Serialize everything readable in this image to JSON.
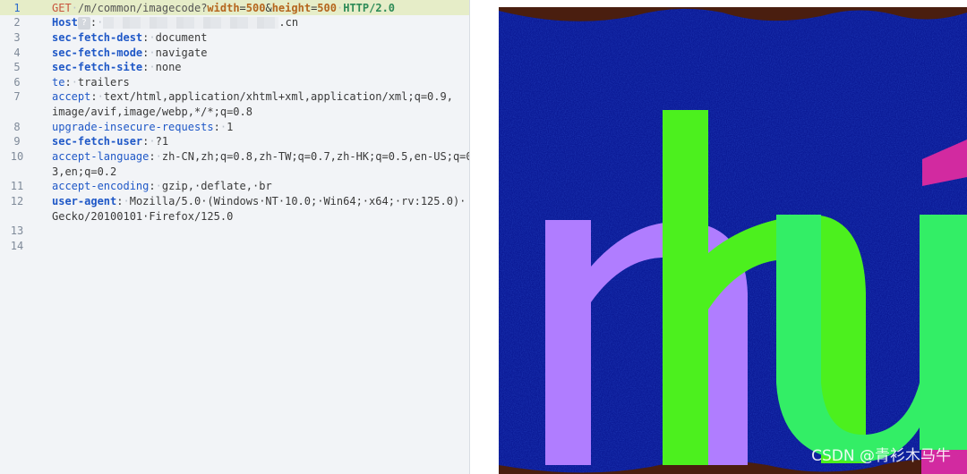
{
  "editor": {
    "line_numbers": [
      "1",
      "2",
      "3",
      "4",
      "5",
      "6",
      "7",
      "8",
      "9",
      "10",
      "11",
      "12",
      "13",
      "14"
    ],
    "request_line": {
      "method": "GET",
      "path": "/m/common/imagecode?",
      "param1_key": "width",
      "param1_eq": "=",
      "param1_val": "500",
      "amp": "&",
      "param2_key": "height",
      "param2_eq": "=",
      "param2_val": "500",
      "protocol": "HTTP/2.0"
    },
    "host": {
      "key": "Host",
      "help_glyph": "?",
      "sep": ":",
      "value_suffix": ".cn"
    },
    "headers": [
      {
        "key": "sec-fetch-dest",
        "sep": ":",
        "value": "document"
      },
      {
        "key": "sec-fetch-mode",
        "sep": ":",
        "value": "navigate"
      },
      {
        "key": "sec-fetch-site",
        "sep": ":",
        "value": "none"
      },
      {
        "key": "te",
        "sep": ":",
        "value": "trailers"
      },
      {
        "key": "accept",
        "sep": ":",
        "value": "text/html,application/xhtml+xml,application/xml;q=0.9,",
        "value_cont": "image/avif,image/webp,*/*;q=0.8"
      },
      {
        "key": "upgrade-insecure-requests",
        "sep": ":",
        "value": "1"
      },
      {
        "key": "sec-fetch-user",
        "sep": ":",
        "value": "?1"
      },
      {
        "key": "accept-language",
        "sep": ":",
        "value": "zh-CN,zh;q=0.8,zh-TW;q=0.7,zh-HK;q=0.5,en-US;q=0.",
        "value_cont": "3,en;q=0.2"
      },
      {
        "key": "accept-encoding",
        "sep": ":",
        "value": "gzip,·deflate,·br"
      },
      {
        "key": "user-agent",
        "sep": ":",
        "value": "Mozilla/5.0·(Windows·NT·10.0;·Win64;·x64;·rv:125.0)·",
        "value_cont": "Gecko/20100101·Firefox/125.0"
      }
    ]
  },
  "captcha": {
    "watermark": "CSDN @青衫木马牛",
    "colors": {
      "background": "#0b1a96",
      "purple": "#b07dff",
      "green": "#4cf01e",
      "mint": "#33ee66",
      "magenta": "#d22aa0",
      "brown": "#4a1e0f"
    }
  }
}
